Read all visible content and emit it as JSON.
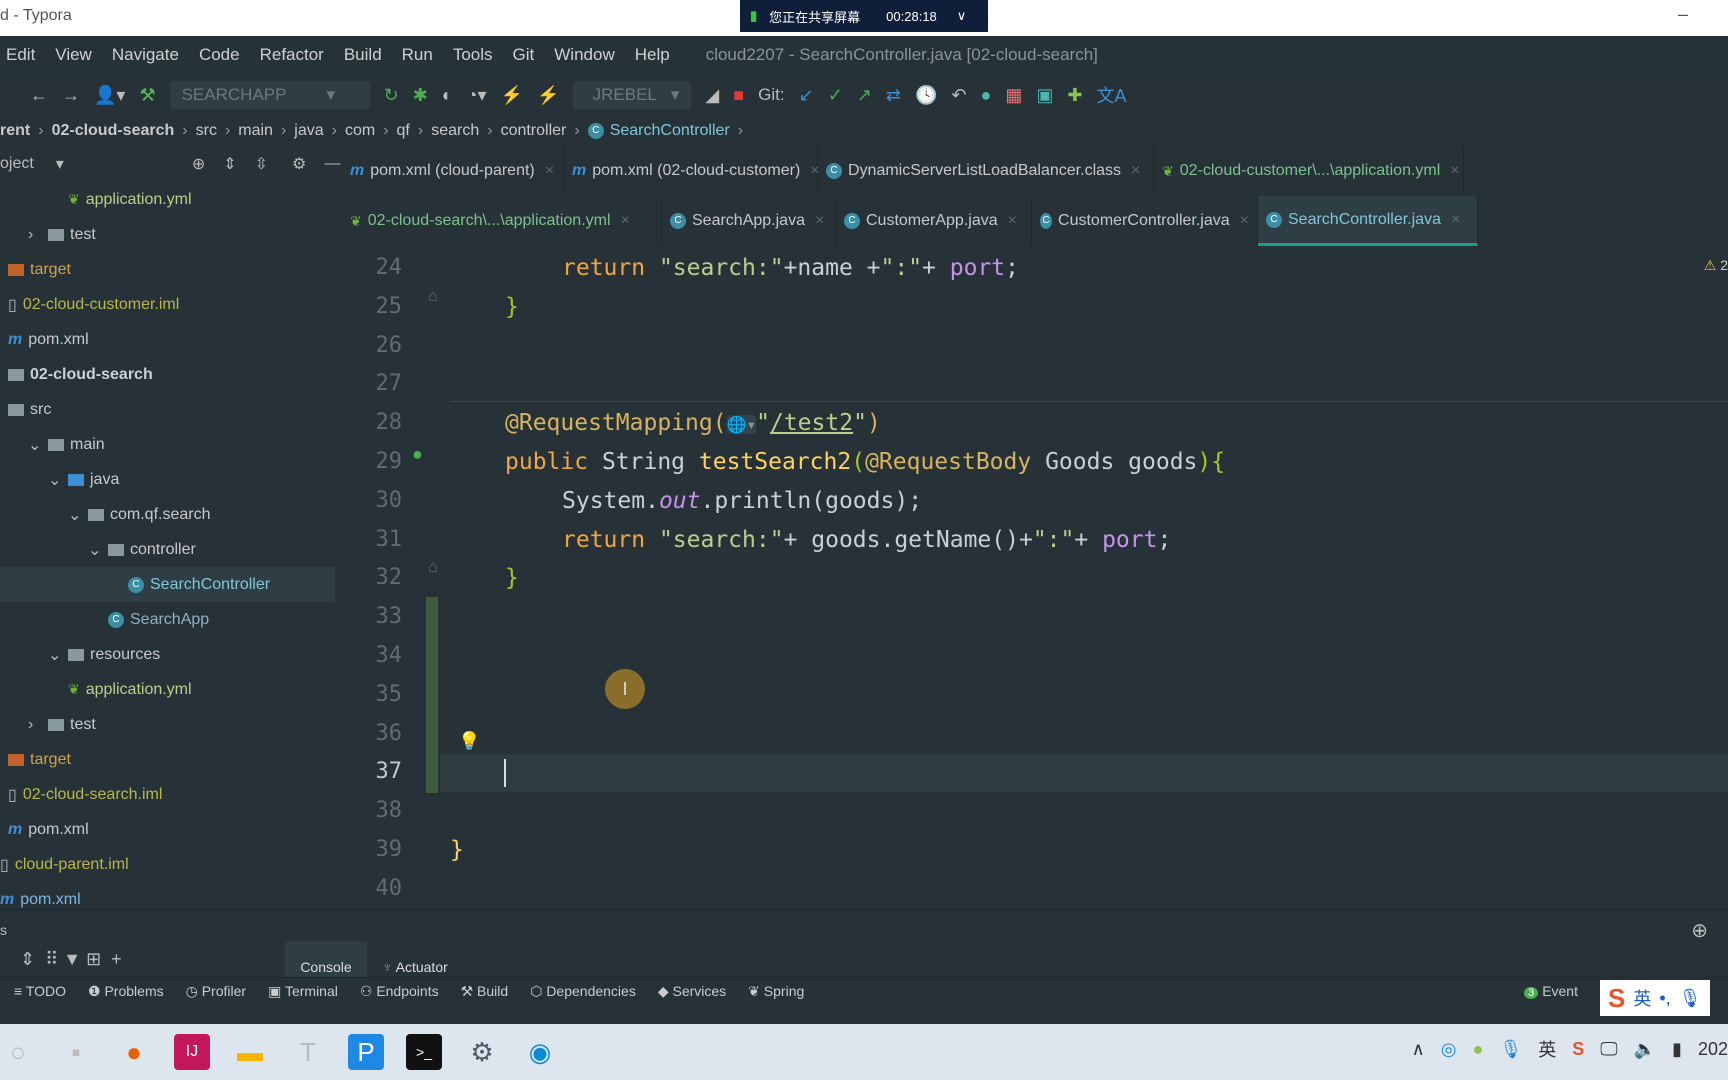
{
  "titlebar": {
    "title": "d - Typora",
    "share_text": "您正在共享屏幕",
    "share_time": "00:28:18"
  },
  "menu": [
    "Edit",
    "View",
    "Navigate",
    "Code",
    "Refactor",
    "Build",
    "Run",
    "Tools",
    "Git",
    "Window",
    "Help"
  ],
  "window_title": "cloud2207 - SearchController.java [02-cloud-search]",
  "toolbar": {
    "run_config": "SEARCHAPP",
    "jrebel": "JREBEL",
    "git_label": "Git:"
  },
  "breadcrumb": [
    "rent",
    "02-cloud-search",
    "src",
    "main",
    "java",
    "com",
    "qf",
    "search",
    "controller",
    "SearchController"
  ],
  "project": {
    "label": "oject",
    "items": [
      {
        "label": "application.yml",
        "type": "yml",
        "depth": 3
      },
      {
        "label": "test",
        "type": "folder",
        "depth": 1,
        "arrow": ">"
      },
      {
        "label": "target",
        "type": "target",
        "depth": 0
      },
      {
        "label": "02-cloud-customer.iml",
        "type": "iml",
        "depth": 0
      },
      {
        "label": "pom.xml",
        "type": "pom",
        "depth": 0
      },
      {
        "label": "02-cloud-search",
        "type": "module",
        "depth": 0
      },
      {
        "label": "src",
        "type": "folder",
        "depth": 0
      },
      {
        "label": "main",
        "type": "folder",
        "depth": 1,
        "arrow": "v"
      },
      {
        "label": "java",
        "type": "blue",
        "depth": 2,
        "arrow": "v"
      },
      {
        "label": "com.qf.search",
        "type": "folder",
        "depth": 3,
        "arrow": "v"
      },
      {
        "label": "controller",
        "type": "folder",
        "depth": 4,
        "arrow": "v"
      },
      {
        "label": "SearchController",
        "type": "class",
        "depth": 6,
        "selected": true
      },
      {
        "label": "SearchApp",
        "type": "app",
        "depth": 5
      },
      {
        "label": "resources",
        "type": "folder",
        "depth": 2,
        "arrow": "v"
      },
      {
        "label": "application.yml",
        "type": "yml",
        "depth": 3
      },
      {
        "label": "test",
        "type": "folder",
        "depth": 1,
        "arrow": ">"
      },
      {
        "label": "target",
        "type": "target",
        "depth": 0
      },
      {
        "label": "02-cloud-search.iml",
        "type": "iml",
        "depth": 0
      },
      {
        "label": "pom.xml",
        "type": "pom",
        "depth": 0
      },
      {
        "label": "cloud-parent.iml",
        "type": "iml",
        "depth": -1
      },
      {
        "label": "pom.xml",
        "type": "pomblue",
        "depth": -1
      }
    ]
  },
  "tabs": [
    {
      "label": "pom.xml (cloud-parent)",
      "icon": "m"
    },
    {
      "label": "pom.xml (02-cloud-customer)",
      "icon": "m"
    },
    {
      "label": "DynamicServerListLoadBalancer.class",
      "icon": "c"
    },
    {
      "label": "02-cloud-customer\\...\\application.yml",
      "icon": "yml"
    },
    {
      "label": "02-cloud-search\\...\\application.yml",
      "icon": "yml"
    },
    {
      "label": "SearchApp.java",
      "icon": "app"
    },
    {
      "label": "CustomerApp.java",
      "icon": "app"
    },
    {
      "label": "CustomerController.java",
      "icon": "c"
    },
    {
      "label": "SearchController.java",
      "icon": "c",
      "active": true
    }
  ],
  "editor": {
    "line_numbers": [
      "24",
      "25",
      "26",
      "27",
      "28",
      "29",
      "30",
      "31",
      "32",
      "33",
      "34",
      "35",
      "36",
      "37",
      "38",
      "39",
      "40"
    ],
    "current_line": "37",
    "warnings": "2"
  },
  "bottom": {
    "panel": "s",
    "console": "Console",
    "actuator": "Actuator",
    "tools": [
      "TODO",
      "Problems",
      "Profiler",
      "Terminal",
      "Endpoints",
      "Build",
      "Dependencies",
      "Services",
      "Spring"
    ],
    "event_count": "3",
    "event": "Event"
  },
  "tray": {
    "ime": "英",
    "clock": "202"
  }
}
